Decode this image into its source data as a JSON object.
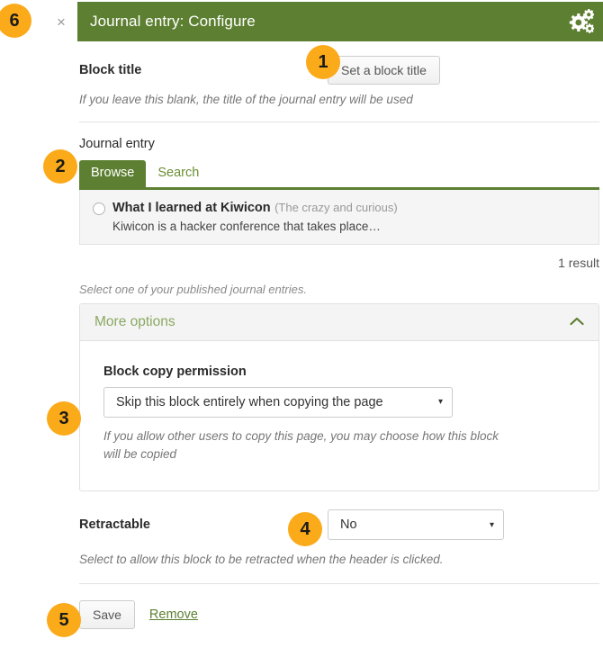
{
  "header": {
    "close_label": "×",
    "title": "Journal entry: Configure",
    "gear_icon": "cogs-icon"
  },
  "block_title": {
    "label": "Block title",
    "button_label": "Set a block title",
    "help": "If you leave this blank, the title of the journal entry will be used"
  },
  "journal_entry": {
    "label": "Journal entry",
    "tabs": [
      {
        "label": "Browse",
        "active": true
      },
      {
        "label": "Search",
        "active": false
      }
    ],
    "results": [
      {
        "title": "What I learned at Kiwicon",
        "subtitle": "(The crazy and curious)",
        "description": "Kiwicon is a hacker conference that takes place…",
        "selected": false
      }
    ],
    "result_count": "1 result",
    "note": "Select one of your published journal entries."
  },
  "more_options": {
    "title": "More options",
    "chevron": "ⱏ",
    "expanded": true,
    "block_copy_permission": {
      "label": "Block copy permission",
      "value": "Skip this block entirely when copying the page",
      "caret": "▾",
      "help": "If you allow other users to copy this page, you may choose how this block will be copied"
    }
  },
  "retractable": {
    "label": "Retractable",
    "value": "No",
    "caret": "▾",
    "help": "Select to allow this block to be retracted when the header is clicked."
  },
  "actions": {
    "save_label": "Save",
    "remove_label": "Remove"
  },
  "callouts": {
    "one": "1",
    "two": "2",
    "three": "3",
    "four": "4",
    "five": "5",
    "six": "6"
  },
  "colors": {
    "brand_green": "#5d7f31",
    "badge_orange": "#fbaa19",
    "panel_gray": "#f4f4f4",
    "list_gray": "#f5f5f5"
  }
}
